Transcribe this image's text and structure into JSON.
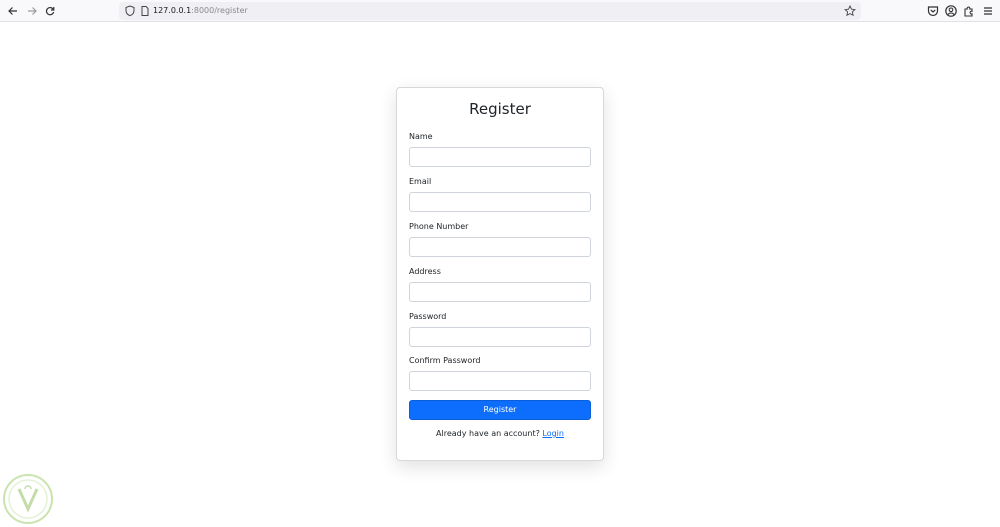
{
  "browser": {
    "url_host": "127.0.0.1",
    "url_rest": ":8000/register"
  },
  "icons": {
    "back": "arrow-left-icon",
    "forward": "arrow-right-icon",
    "reload": "reload-icon",
    "shield": "shield-icon",
    "page": "page-icon",
    "star": "bookmark-star-icon",
    "pocket": "pocket-icon",
    "account": "account-icon",
    "extensions": "extensions-icon",
    "menu": "hamburger-menu-icon"
  },
  "form": {
    "title": "Register",
    "fields": [
      {
        "label": "Name",
        "value": "",
        "placeholder": ""
      },
      {
        "label": "Email",
        "value": "",
        "placeholder": ""
      },
      {
        "label": "Phone Number",
        "value": "",
        "placeholder": ""
      },
      {
        "label": "Address",
        "value": "",
        "placeholder": ""
      },
      {
        "label": "Password",
        "value": "",
        "placeholder": ""
      },
      {
        "label": "Confirm Password",
        "value": "",
        "placeholder": ""
      }
    ],
    "submit_label": "Register",
    "login_prompt": "Already have an account?",
    "login_link": "Login"
  },
  "colors": {
    "primary": "#0d6efd",
    "text": "#212529",
    "input_border": "#ced4da",
    "watermark": "#7cb342"
  }
}
